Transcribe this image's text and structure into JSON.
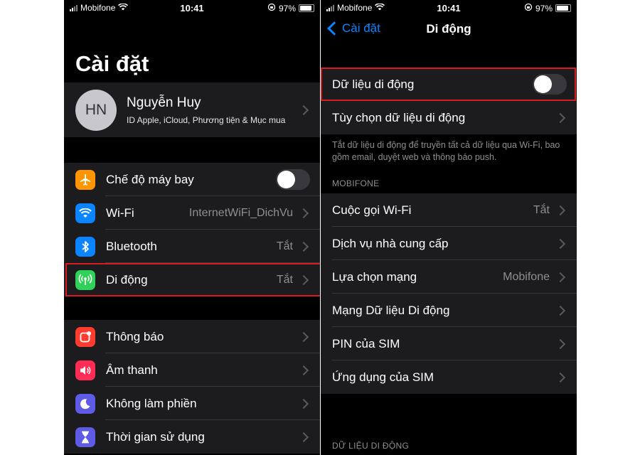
{
  "status": {
    "carrier": "Mobifone",
    "time": "10:41",
    "battery": "97%"
  },
  "left": {
    "title": "Cài đặt",
    "profile": {
      "initials": "HN",
      "name": "Nguyễn Huy",
      "subtitle": "ID Apple, iCloud, Phương tiện & Mục mua"
    },
    "connectivity": [
      {
        "label": "Chế độ máy bay",
        "icon": "airplane-icon",
        "color": "#ff9500",
        "toggle": false
      },
      {
        "label": "Wi-Fi",
        "icon": "wifi-icon",
        "color": "#0a84ff",
        "value": "InternetWiFi_DichVu"
      },
      {
        "label": "Bluetooth",
        "icon": "bluetooth-icon",
        "color": "#0a84ff",
        "value": "Tắt"
      },
      {
        "label": "Di động",
        "icon": "cellular-icon",
        "color": "#30d158",
        "value": "Tắt"
      }
    ],
    "notifications": [
      {
        "label": "Thông báo",
        "icon": "notifications-icon",
        "color": "#ff3b30"
      },
      {
        "label": "Âm thanh",
        "icon": "sound-icon",
        "color": "#ff2d55"
      },
      {
        "label": "Không làm phiền",
        "icon": "moon-icon",
        "color": "#5e5ce6"
      },
      {
        "label": "Thời gian sử dụng",
        "icon": "hourglass-icon",
        "color": "#5e5ce6"
      }
    ]
  },
  "right": {
    "back_label": "Cài đặt",
    "title": "Di động",
    "mobile_data": {
      "label": "Dữ liệu di động",
      "toggle": false
    },
    "data_options": "Tùy chọn dữ liệu di động",
    "footnote": "Tắt dữ liệu di động để truyền tất cả dữ liệu qua Wi-Fi, bao gồm email, duyệt web và thông báo push.",
    "section_mobifone": "MOBIFONE",
    "carrier_rows": [
      {
        "label": "Cuộc gọi Wi-Fi",
        "value": "Tắt"
      },
      {
        "label": "Dịch vụ nhà cung cấp",
        "value": ""
      },
      {
        "label": "Lựa chọn mạng",
        "value": "Mobifone"
      },
      {
        "label": "Mạng Dữ liệu Di động",
        "value": ""
      },
      {
        "label": "PIN của SIM",
        "value": ""
      },
      {
        "label": "Ứng dụng của SIM",
        "value": ""
      }
    ],
    "section_data": "DỮ LIỆU DI ĐỘNG"
  },
  "highlight_color": "#d71b20"
}
